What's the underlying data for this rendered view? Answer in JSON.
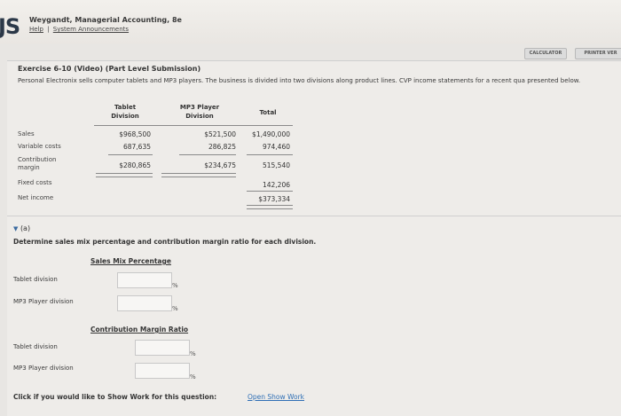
{
  "header": {
    "logo": "JS",
    "book_title": "Weygandt, Managerial Accounting, 8e",
    "links": {
      "help": "Help",
      "separator": "|",
      "system": "System Announcements"
    }
  },
  "toolbar": {
    "calculator": "CALCULATOR",
    "printer": "PRINTER VER"
  },
  "exercise": {
    "title": "Exercise 6-10 (Video) (Part Level Submission)",
    "description": "Personal Electronix sells computer tablets and MP3 players. The business is divided into two divisions along product lines. CVP income statements for a recent qua presented below."
  },
  "table": {
    "headers": {
      "tablet": "Tablet Division",
      "mp3": "MP3 Player Division",
      "total": "Total"
    },
    "rows": [
      {
        "label": "Sales",
        "tablet": "$968,500",
        "mp3": "$521,500",
        "total": "$1,490,000"
      },
      {
        "label": "Variable costs",
        "tablet": "687,635",
        "mp3": "286,825",
        "total": "974,460"
      },
      {
        "label": "Contribution margin",
        "tablet": "$280,865",
        "mp3": "$234,675",
        "total": "515,540"
      },
      {
        "label": "Fixed costs",
        "tablet": "",
        "mp3": "",
        "total": "142,206"
      },
      {
        "label": "Net income",
        "tablet": "",
        "mp3": "",
        "total": "$373,334"
      }
    ]
  },
  "part_a": {
    "label": "(a)",
    "instruction": "Determine sales mix percentage and contribution margin ratio for each division.",
    "sales_mix": {
      "heading": "Sales Mix Percentage",
      "tablet_label": "Tablet division",
      "mp3_label": "MP3 Player division",
      "unit": "%"
    },
    "cm_ratio": {
      "heading": "Contribution Margin Ratio",
      "tablet_label": "Tablet division",
      "mp3_label": "MP3 Player division",
      "unit": "%"
    }
  },
  "footer": {
    "prompt": "Click if you would like to Show Work for this question:",
    "link": "Open Show Work"
  }
}
